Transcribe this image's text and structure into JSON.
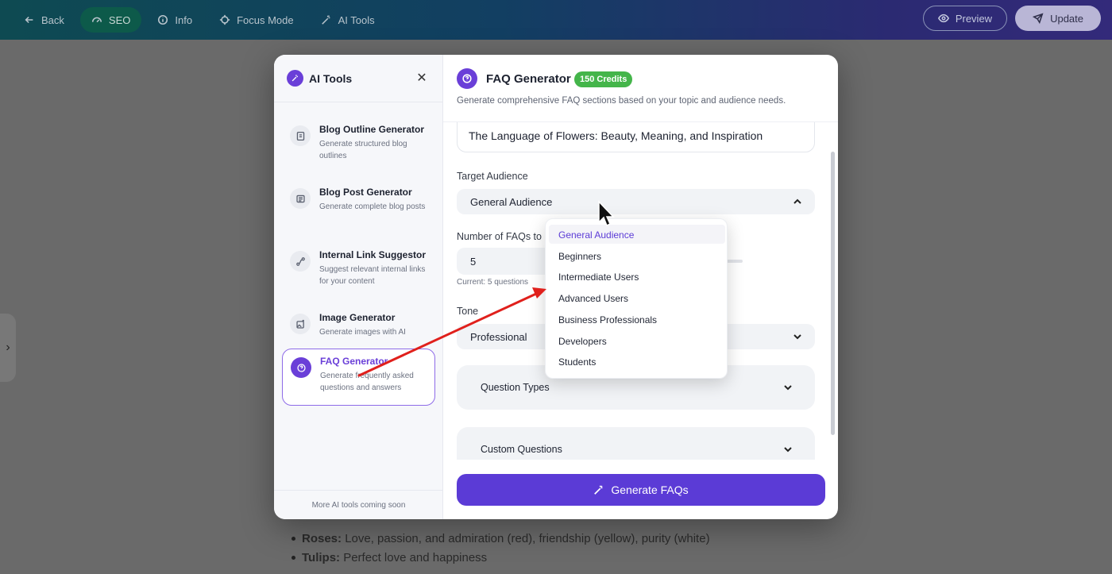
{
  "topbar": {
    "back_label": "Back",
    "seo_label": "SEO",
    "info_label": "Info",
    "focus_label": "Focus Mode",
    "aitools_label": "AI Tools",
    "preview_label": "Preview",
    "update_label": "Update"
  },
  "editor": {
    "bullets": [
      {
        "term": "Roses:",
        "text": " Love, passion, and admiration (red), friendship (yellow), purity (white)"
      },
      {
        "term": "Tulips:",
        "text": " Perfect love and happiness"
      }
    ]
  },
  "modal": {
    "sidebar": {
      "title": "AI Tools",
      "footer": "More AI tools coming soon",
      "tools": [
        {
          "name": "Blog Outline Generator",
          "desc": "Generate structured blog outlines",
          "icon": "document-icon"
        },
        {
          "name": "Blog Post Generator",
          "desc": "Generate complete blog posts",
          "icon": "article-icon"
        },
        {
          "name": "Internal Link Suggestor",
          "desc": "Suggest relevant internal links for your content",
          "icon": "route-icon"
        },
        {
          "name": "Image Generator",
          "desc": "Generate images with AI",
          "icon": "image-sparkle-icon"
        },
        {
          "name": "FAQ Generator",
          "desc": "Generate frequently asked questions and answers",
          "icon": "question-icon",
          "selected": true
        }
      ]
    },
    "panel": {
      "title": "FAQ Generator",
      "credits": "150 Credits",
      "subtitle": "Generate comprehensive FAQ sections based on your topic and audience needs.",
      "topic_value": "The Language of Flowers: Beauty, Meaning, and Inspiration",
      "audience_label": "Target Audience",
      "audience_value": "General Audience",
      "num_label": "Number of FAQs to G",
      "num_value": "5",
      "num_hint": "Current: 5 questions",
      "tone_label": "Tone",
      "tone_value": "Professional",
      "question_types_label": "Question Types",
      "custom_questions_label": "Custom Questions",
      "generate_label": "Generate FAQs"
    },
    "audience_options": [
      "General Audience",
      "Beginners",
      "Intermediate Users",
      "Advanced Users",
      "Business Professionals",
      "Developers",
      "Students"
    ],
    "audience_selected_index": 0
  },
  "colors": {
    "accent": "#5b3bd6",
    "credits_badge": "#44b54a",
    "annotation_arrow": "#e0201c"
  }
}
